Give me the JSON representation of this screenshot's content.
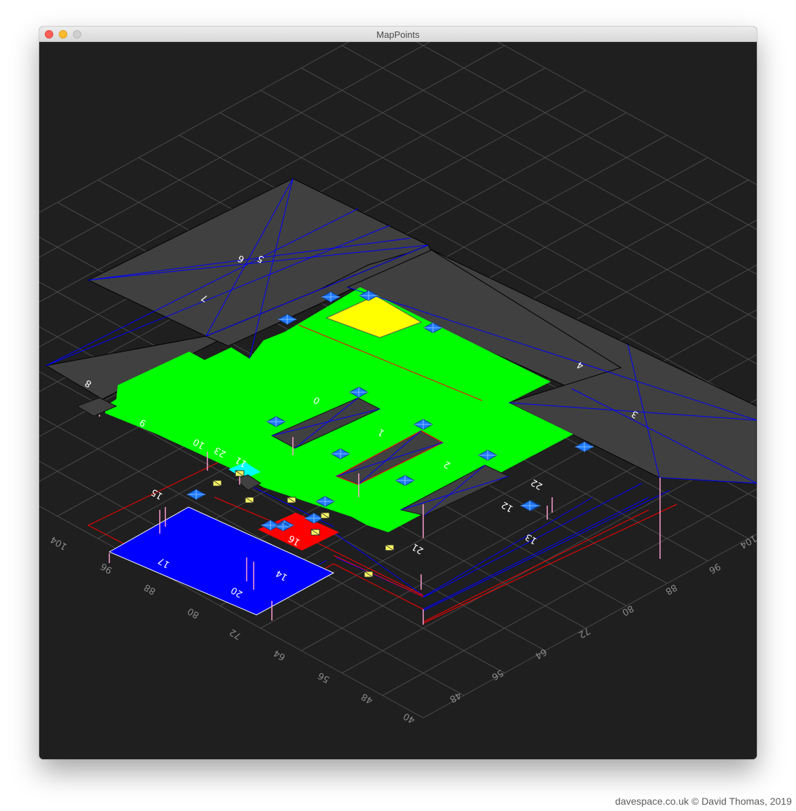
{
  "window": {
    "title": "MapPoints"
  },
  "watermark": "davespace.co.uk © David Thomas, 2019",
  "axes": {
    "left_ticks": [
      "104",
      "96",
      "88",
      "80",
      "72",
      "64",
      "56",
      "48",
      "40"
    ],
    "right_ticks": [
      "104",
      "96",
      "88",
      "80",
      "72",
      "64",
      "56",
      "48"
    ]
  },
  "zone_labels": [
    "0",
    "1",
    "2",
    "3",
    "4",
    "5",
    "6",
    "7",
    "8",
    "9",
    "10",
    "11",
    "12",
    "13",
    "14",
    "15",
    "16",
    "17",
    "20",
    "21",
    "22",
    "23"
  ],
  "colors": {
    "background": "#1f1f1f",
    "grid": "#4a4a4a",
    "roof": "#3f3f3f",
    "floor": "#00ff00",
    "yellow_zone": "#ffff00",
    "red_zone": "#ff0000",
    "blue_zone": "#0000ff",
    "cyan_zone": "#00ffff",
    "marker": "#1e78ff",
    "outline_blue": "#0000ff",
    "outline_red": "#ff0000",
    "pin": "#ff9fd0"
  }
}
